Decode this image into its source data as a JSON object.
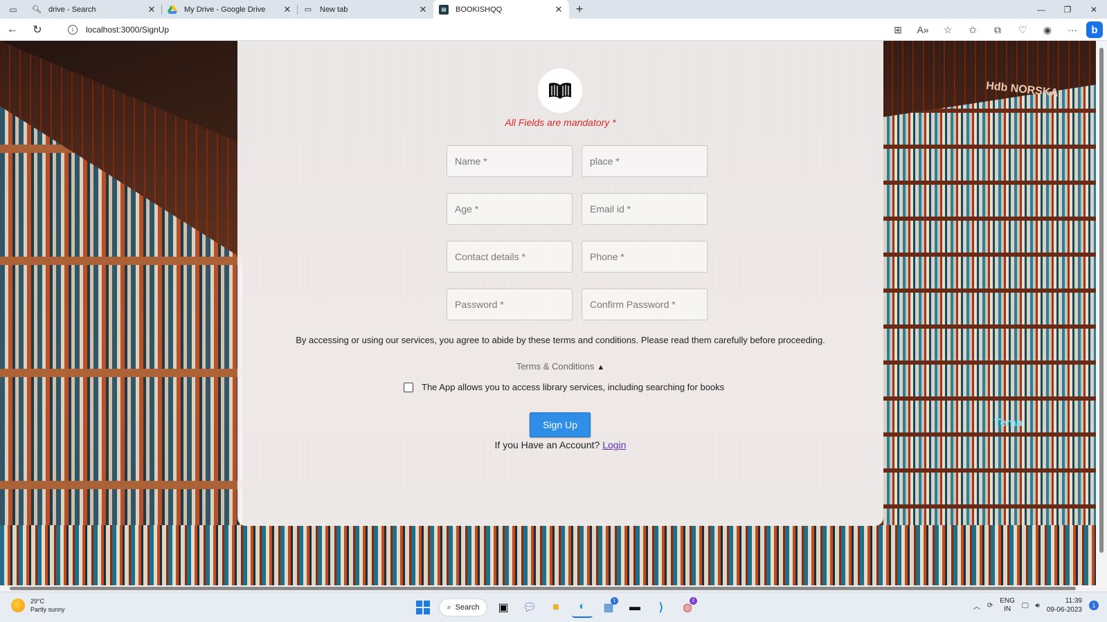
{
  "browser": {
    "tabs": [
      {
        "title": "drive - Search",
        "icon": "search-icon"
      },
      {
        "title": "My Drive - Google Drive",
        "icon": "google-drive-icon"
      },
      {
        "title": "New tab",
        "icon": "page-icon"
      },
      {
        "title": "BOOKISHQQ",
        "icon": "book-icon"
      }
    ],
    "url": "localhost:3000/SignUp"
  },
  "page": {
    "mandatory_note": "All Fields are mandatory *",
    "fields": {
      "name": "Name *",
      "place": "place *",
      "age": "Age *",
      "email": "Email id *",
      "contact": "Contact details *",
      "phone": "Phone *",
      "password": "Password *",
      "confirm_password": "Confirm Password *"
    },
    "terms_text": "By accessing or using our services, you agree to abide by these terms and conditions. Please read them carefully before proceeding.",
    "terms_toggle": "Terms & Conditions",
    "agree_label": "The App allows you to access library services, including searching for books",
    "signup_button": "Sign Up",
    "login_prompt": "If you Have an Account?",
    "login_link": "Login",
    "background_signs": [
      "Hdb NORSKA",
      "Tema"
    ]
  },
  "taskbar": {
    "weather_temp": "29°C",
    "weather_desc": "Partly sunny",
    "search_label": "Search",
    "lang_line1": "ENG",
    "lang_line2": "IN",
    "time": "11:39",
    "date": "09-06-2023",
    "store_badge": "1",
    "chrome_badge": "2",
    "notification_count": "1"
  }
}
